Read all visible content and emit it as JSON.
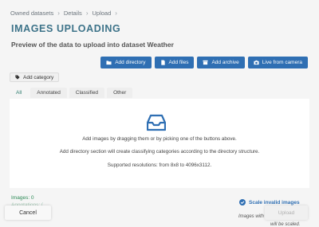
{
  "breadcrumb": [
    "Owned datasets",
    "Details",
    "Upload"
  ],
  "breadcrumb_separator": "›",
  "title": "IMAGES UPLOADING",
  "subtitle": "Preview of the data to upload into dataset Weather",
  "actions": {
    "add_directory": "Add directory",
    "add_files": "Add files",
    "add_archive": "Add archive",
    "live_camera": "Live from camera"
  },
  "add_category": "Add category",
  "tabs": [
    "All",
    "Annotated",
    "Classified",
    "Other"
  ],
  "active_tab": "All",
  "dropzone": {
    "line1": "Add images by dragging them or by picking one of the buttons above.",
    "line2": "Add directory section will create classifying categories according to the directory structure.",
    "line3": "Supported resolutions: from 8x8 to 4096x3112."
  },
  "status": {
    "images": "Images: 0",
    "annotations_partial": "Annotations: 0"
  },
  "footer": {
    "cancel": "Cancel",
    "upload": "Upload",
    "scale_invalid": "Scale invalid images",
    "scale_checked": true,
    "note_line1": "Images with",
    "note_line2": "will be scaled."
  },
  "colors": {
    "accent": "#2f6fb3",
    "title": "#3d7389",
    "success": "#2e8b57"
  }
}
